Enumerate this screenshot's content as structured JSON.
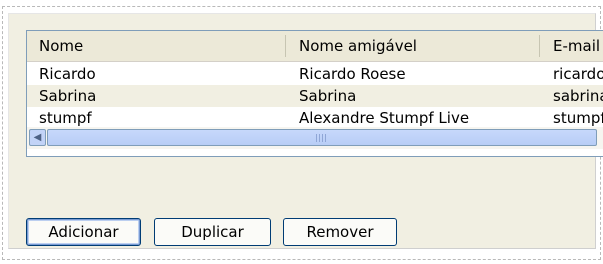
{
  "table": {
    "headers": [
      "Nome",
      "Nome amigável",
      "E-mail"
    ],
    "rows": [
      [
        "Ricardo",
        "Ricardo Roese",
        "ricardo"
      ],
      [
        "Sabrina",
        "Sabrina",
        "sabrina"
      ],
      [
        "stumpf",
        "Alexandre Stumpf Live",
        "stumpf"
      ]
    ],
    "selected_row": 1
  },
  "scrollbar": {
    "left_arrow": "◀"
  },
  "buttons": {
    "add": "Adicionar",
    "duplicate": "Duplicar",
    "remove": "Remover"
  },
  "colors": {
    "selected_row_bg": "#f1efe2",
    "grid_border": "#7f9db9",
    "button_border": "#003c74"
  }
}
